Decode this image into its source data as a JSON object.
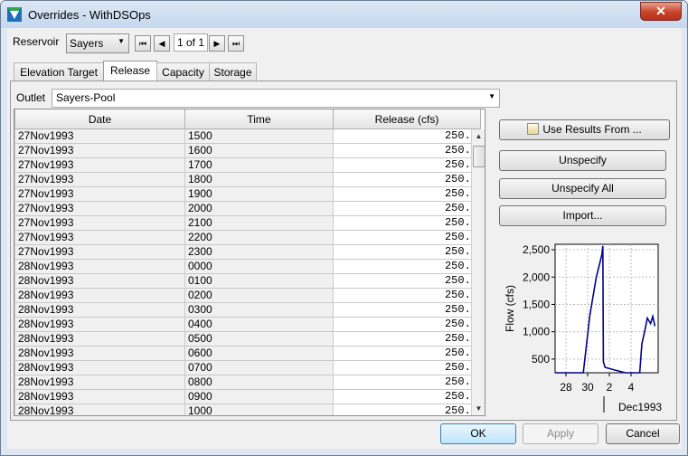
{
  "window": {
    "title": "Overrides - WithDSOps",
    "close_glyph": "✕"
  },
  "reservoir": {
    "label": "Reservoir",
    "selected": "Sayers",
    "record": "1 of 1"
  },
  "nav_icons": [
    "first-record-icon",
    "previous-record-icon",
    "next-record-icon",
    "last-record-icon"
  ],
  "tabs": [
    {
      "label": "Elevation Target",
      "active": false
    },
    {
      "label": "Release",
      "active": true
    },
    {
      "label": "Capacity",
      "active": false
    },
    {
      "label": "Storage",
      "active": false
    }
  ],
  "outlet": {
    "label": "Outlet",
    "selected": "Sayers-Pool"
  },
  "table": {
    "columns": [
      "Date",
      "Time",
      "Release (cfs)"
    ],
    "rows": [
      [
        "27Nov1993",
        "1500",
        "250.0"
      ],
      [
        "27Nov1993",
        "1600",
        "250.0"
      ],
      [
        "27Nov1993",
        "1700",
        "250.0"
      ],
      [
        "27Nov1993",
        "1800",
        "250.0"
      ],
      [
        "27Nov1993",
        "1900",
        "250.0"
      ],
      [
        "27Nov1993",
        "2000",
        "250.0"
      ],
      [
        "27Nov1993",
        "2100",
        "250.0"
      ],
      [
        "27Nov1993",
        "2200",
        "250.0"
      ],
      [
        "27Nov1993",
        "2300",
        "250.0"
      ],
      [
        "28Nov1993",
        "0000",
        "250.0"
      ],
      [
        "28Nov1993",
        "0100",
        "250.0"
      ],
      [
        "28Nov1993",
        "0200",
        "250.0"
      ],
      [
        "28Nov1993",
        "0300",
        "250.0"
      ],
      [
        "28Nov1993",
        "0400",
        "250.0"
      ],
      [
        "28Nov1993",
        "0500",
        "250.0"
      ],
      [
        "28Nov1993",
        "0600",
        "250.0"
      ],
      [
        "28Nov1993",
        "0700",
        "250.0"
      ],
      [
        "28Nov1993",
        "0800",
        "250.0"
      ],
      [
        "28Nov1993",
        "0900",
        "250.0"
      ],
      [
        "28Nov1993",
        "1000",
        "250.0"
      ]
    ]
  },
  "buttons": {
    "use_results": "Use Results From ...",
    "unspecify": "Unspecify",
    "unspecify_all": "Unspecify All",
    "import": "Import...",
    "ok": "OK",
    "apply": "Apply",
    "cancel": "Cancel"
  },
  "chart_data": {
    "type": "line",
    "ylabel": "Flow (cfs)",
    "xlabel": "Dec1993",
    "yticks": [
      "2,500",
      "2,000",
      "1,500",
      "1,000",
      "500"
    ],
    "xticks": [
      "28",
      "30",
      "2",
      "4"
    ],
    "ylim": [
      250,
      2600
    ],
    "xlim": [
      27,
      36.5
    ],
    "grid": true,
    "series": [
      {
        "color": "#00008b",
        "x": [
          27.0,
          28.0,
          29.0,
          29.6,
          30.2,
          30.8,
          31.3,
          31.4,
          31.45,
          31.6,
          32.5,
          33.5,
          34.4,
          34.5,
          34.8,
          35.0,
          35.3,
          35.5,
          35.8,
          36.0,
          36.2
        ],
        "y": [
          250,
          250,
          250,
          250,
          1300,
          2000,
          2400,
          2570,
          450,
          350,
          300,
          250,
          250,
          250,
          250,
          780,
          1050,
          1250,
          1150,
          1280,
          1100
        ]
      }
    ]
  },
  "colors": {
    "series": "#00008b",
    "title_bar": "#c6d8ee",
    "close_button": "#c8432a"
  }
}
